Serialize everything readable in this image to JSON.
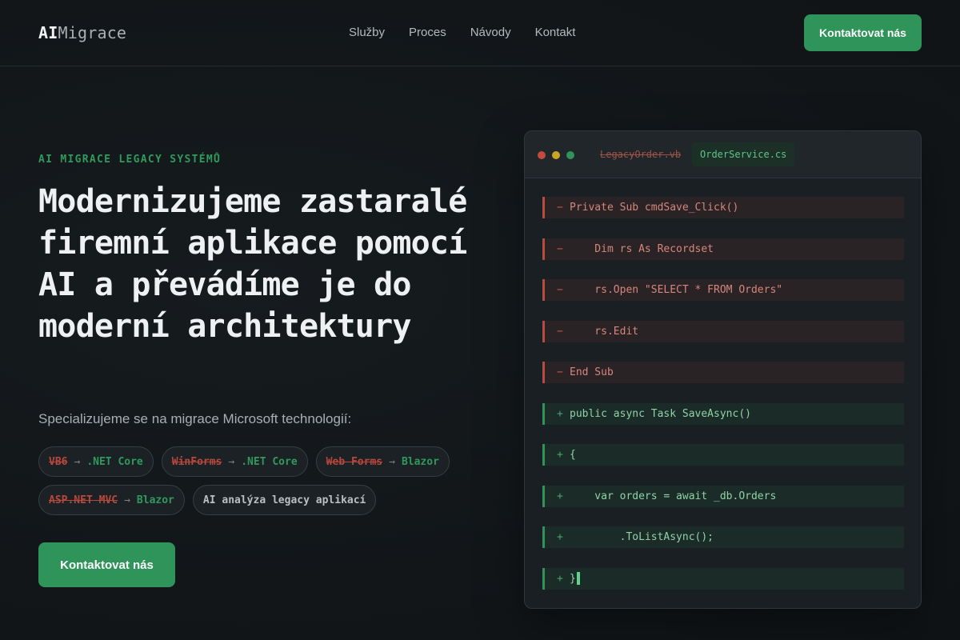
{
  "header": {
    "logo_strong": "AI",
    "logo_light": "Migrace",
    "nav": [
      "Služby",
      "Proces",
      "Návody",
      "Kontakt"
    ],
    "cta_label": "Kontaktovat nás"
  },
  "hero": {
    "eyebrow": "AI MIGRACE LEGACY SYSTÉMŮ",
    "title": "Modernizujeme zastaralé firemní aplikace pomocí AI a převádíme je do moderní architektury",
    "subtitle": "Specializujeme se na migrace Microsoft technologií:",
    "chips": [
      {
        "old": "VB6",
        "arrow": "→",
        "new": ".NET Core"
      },
      {
        "old": "WinForms",
        "arrow": "→",
        "new": ".NET Core"
      },
      {
        "old": "Web Forms",
        "arrow": "→",
        "new": "Blazor"
      },
      {
        "old": "ASP.NET MVC",
        "arrow": "→",
        "new": "Blazor"
      },
      {
        "plain": "AI analýza legacy aplikací"
      }
    ],
    "cta_label": "Kontaktovat nás"
  },
  "code_window": {
    "tab_legacy": "LegacyOrder.vb",
    "tab_active": "OrderService.cs",
    "lines": [
      {
        "type": "removed",
        "sign": "−",
        "text": "Private Sub cmdSave_Click()"
      },
      {
        "type": "removed",
        "sign": "−",
        "text": "    Dim rs As Recordset"
      },
      {
        "type": "removed",
        "sign": "−",
        "text": "    rs.Open \"SELECT * FROM Orders\""
      },
      {
        "type": "removed",
        "sign": "−",
        "text": "    rs.Edit"
      },
      {
        "type": "removed",
        "sign": "−",
        "text": "End Sub"
      },
      {
        "type": "added",
        "sign": "+",
        "text": "public async Task SaveAsync()"
      },
      {
        "type": "added",
        "sign": "+",
        "text": "{"
      },
      {
        "type": "added",
        "sign": "+",
        "text": "    var orders = await _db.Orders"
      },
      {
        "type": "added",
        "sign": "+",
        "text": "        .ToListAsync();"
      },
      {
        "type": "added",
        "sign": "+",
        "text": "}"
      }
    ]
  },
  "colors": {
    "accent": "#2f9459",
    "removed": "#b84a3f",
    "background": "#121619"
  }
}
